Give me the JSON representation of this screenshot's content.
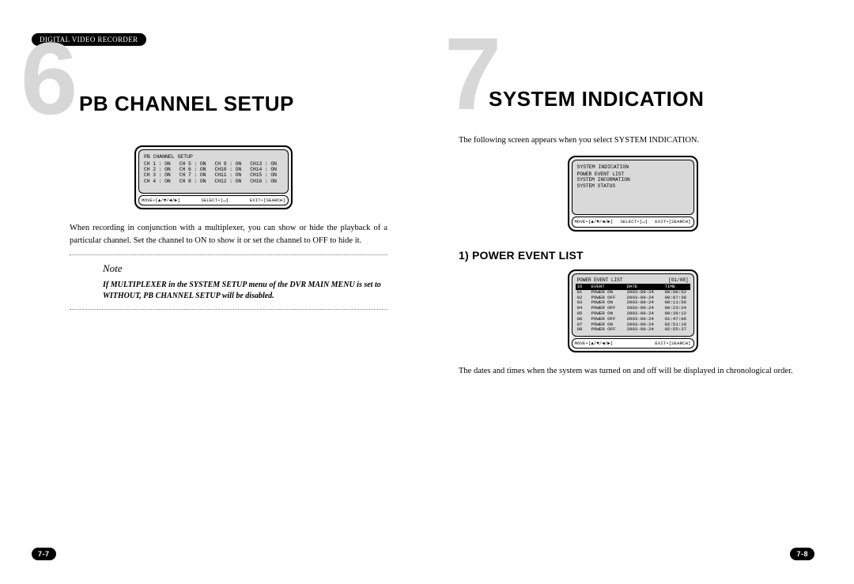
{
  "left": {
    "header_badge": "DIGITAL VIDEO RECORDER",
    "chapter_num": "6",
    "title": "PB CHANNEL SETUP",
    "osd_title": "PB CHANNEL SETUP",
    "channels": [
      "CH 1 : ON",
      "CH 5 : ON",
      "CH 9 : ON",
      "CH13 : ON",
      "CH 2 : ON",
      "CH 6 : ON",
      "CH10 : ON",
      "CH14 : ON",
      "CH 3 : ON",
      "CH 7 : ON",
      "CH11 : ON",
      "CH15 : ON",
      "CH 4 : ON",
      "CH 8 : ON",
      "CH12 : ON",
      "CH16 : ON"
    ],
    "osd_footer": {
      "move": "MOVE•[▲/▼/◀/▶]",
      "select": "SELECT•[↵]",
      "exit": "EXIT•[SEARCH]"
    },
    "paragraph": "When recording in conjunction with a multiplexer, you can show or hide the playback of a particular channel. Set the channel to ON to show it or set the channel to OFF to hide it.",
    "note_label": "Note",
    "note_body": "If MULTIPLEXER in the SYSTEM SETUP menu of the DVR MAIN MENU is set to WITHOUT, PB CHANNEL SETUP will be disabled.",
    "page_num": "7-7"
  },
  "right": {
    "chapter_num": "7",
    "title": "SYSTEM INDICATION",
    "intro": "The following screen appears when you select SYSTEM INDICATION.",
    "osd_sys": {
      "title": "SYSTEM INDICATION",
      "items": [
        "POWER EVENT LIST",
        "SYSTEM INFORMATION",
        "SYSTEM STATUS"
      ],
      "footer": {
        "move": "MOVE•[▲/▼/◀/▶]",
        "select": "SELECT•[↵]",
        "exit": "EXIT•[SEARCH]"
      }
    },
    "subhead": "1) POWER EVENT LIST",
    "pel": {
      "head_left": "POWER EVENT LIST",
      "head_right": "[01/08]",
      "thead": {
        "id": "ID",
        "event": "EVENT",
        "date": "DATE",
        "time": "TIME"
      },
      "rows": [
        {
          "id": "01",
          "event": "POWER ON",
          "date": "2003-09-24",
          "time": "00:00:52"
        },
        {
          "id": "02",
          "event": "POWER OFF",
          "date": "2003-09-24",
          "time": "00:07:38"
        },
        {
          "id": "03",
          "event": "POWER ON",
          "date": "2003-09-24",
          "time": "00:11:56"
        },
        {
          "id": "04",
          "event": "POWER OFF",
          "date": "2003-09-24",
          "time": "00:23:24"
        },
        {
          "id": "05",
          "event": "POWER ON",
          "date": "2003-09-24",
          "time": "00:39:12"
        },
        {
          "id": "06",
          "event": "POWER OFF",
          "date": "2003-09-24",
          "time": "01:47:06"
        },
        {
          "id": "07",
          "event": "POWER ON",
          "date": "2003-09-24",
          "time": "02:51:10"
        },
        {
          "id": "08",
          "event": "POWER OFF",
          "date": "2003-09-24",
          "time": "02:55:37"
        }
      ],
      "footer": {
        "move": "MOVE•[▲/▼/◀/▶]",
        "exit": "EXIT•[SEARCH]"
      }
    },
    "paragraph": "The dates and times when the system was turned on and off will be displayed in chronological order.",
    "page_num": "7-8"
  }
}
